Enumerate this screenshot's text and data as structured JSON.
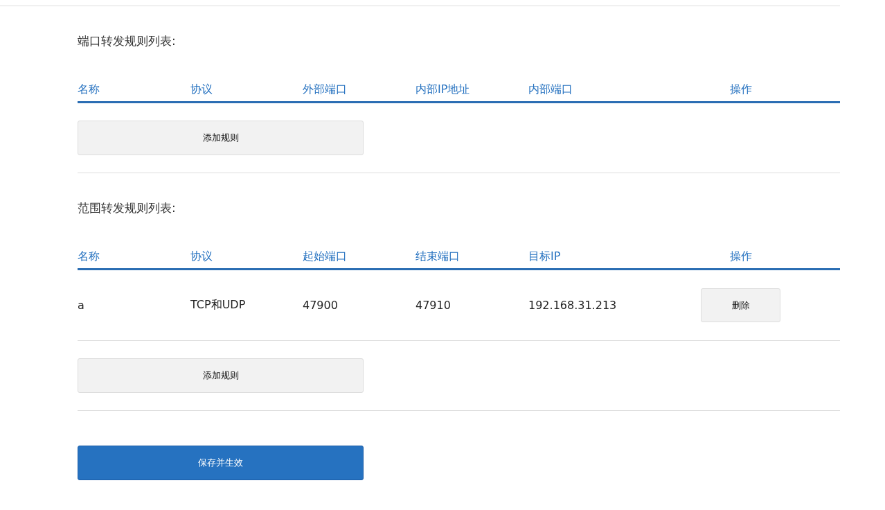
{
  "sections": [
    {
      "title": "端口转发规则列表:",
      "columns": [
        "名称",
        "协议",
        "外部端口",
        "内部IP地址",
        "内部端口",
        "操作"
      ],
      "add_button": "添加规则"
    },
    {
      "title": "范围转发规则列表:",
      "columns": [
        "名称",
        "协议",
        "起始端口",
        "结束端口",
        "目标IP",
        "操作"
      ],
      "rows": [
        {
          "cells": [
            "a",
            "TCP和UDP",
            "47900",
            "47910",
            "192.168.31.213"
          ],
          "action": "删除"
        }
      ],
      "add_button": "添加规则"
    }
  ],
  "save_button": "保存并生效"
}
